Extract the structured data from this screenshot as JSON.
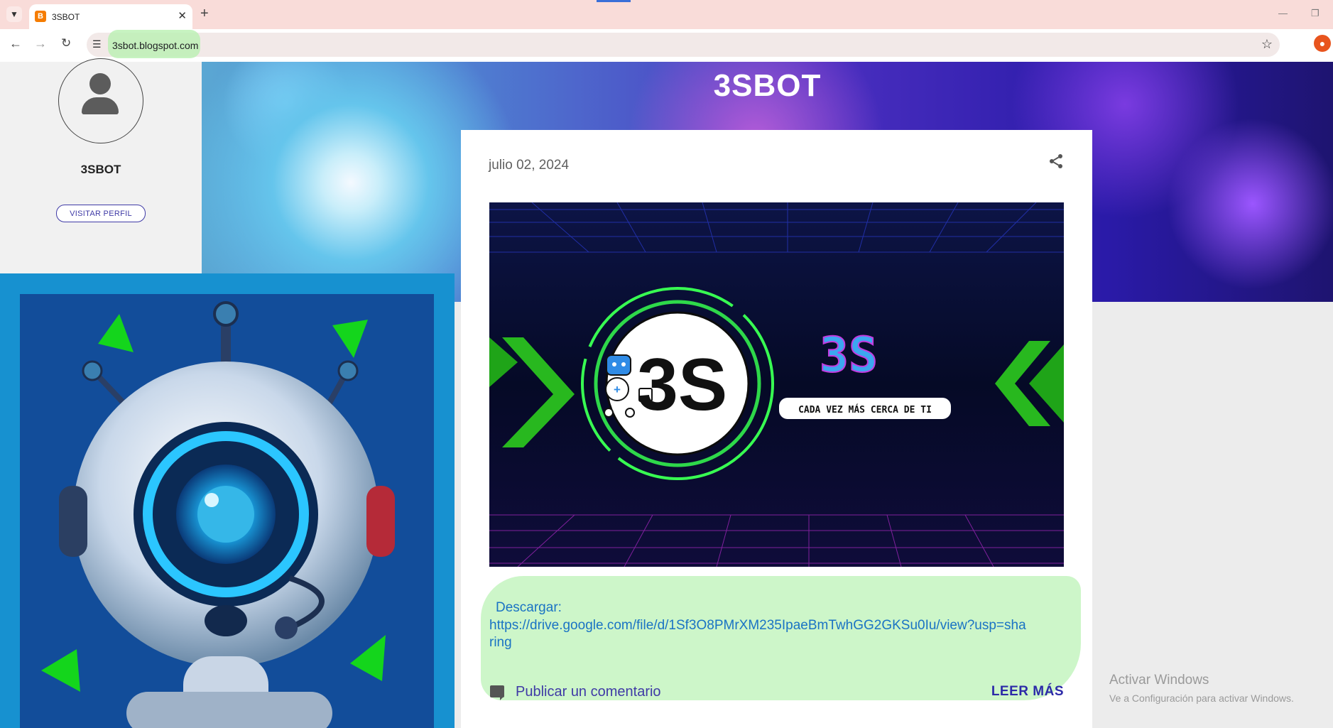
{
  "browser": {
    "tab_title": "3SBOT",
    "favicon_letter": "B",
    "url": "3sbot.blogspot.com",
    "caret_icon": "chevron-down-icon",
    "new_tab_symbol": "+",
    "close_symbol": "✕"
  },
  "blog": {
    "title": "3SBOT"
  },
  "profile": {
    "name": "3SBOT",
    "visit_button": "VISITAR PERFIL"
  },
  "post": {
    "date": "julio 02, 2024",
    "banner": {
      "logo_text": "3S",
      "big_text": "3S",
      "tagline": "CADA VEZ MÁS CERCA DE TI"
    },
    "download_label": "Descargar:",
    "download_link": "https://drive.google.com/file/d/1Sf3O8PMrXM235IpaeBmTwhGG2GKSu0Iu/view?usp=sharing",
    "comment_link": "Publicar un comentario",
    "read_more": "LEER MÁS"
  },
  "watermark": {
    "line1": "Activar Windows",
    "line2": "Ve a Configuración para activar Windows."
  },
  "colors": {
    "accent": "#3f3aa6",
    "link": "#1a73c4",
    "neon_green": "#22ff44",
    "robot_bg": "#124d9a"
  }
}
